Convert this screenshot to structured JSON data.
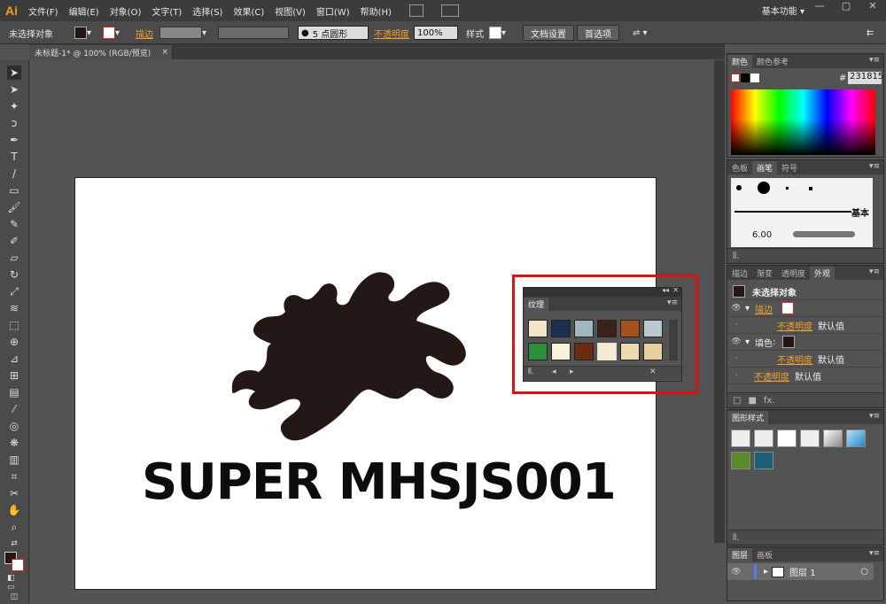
{
  "app": {
    "logo": "Ai"
  },
  "menubar": {
    "items": [
      "文件(F)",
      "编辑(E)",
      "对象(O)",
      "文字(T)",
      "选择(S)",
      "效果(C)",
      "视图(V)",
      "窗口(W)",
      "帮助(H)"
    ],
    "workspace": "基本功能"
  },
  "controlbar": {
    "selection": "未选择对象",
    "stroke_label": "描边",
    "brush_value": "5 点圆形",
    "opacity_label": "不透明度",
    "opacity_value": "100%",
    "style_label": "样式",
    "doc_setup_button": "文档设置",
    "preferences_button": "首选项"
  },
  "document": {
    "tab_title": "未标题-1* @ 100% (RGB/预览)",
    "artwork_text": "SUPER MHSJS001"
  },
  "texture_panel": {
    "title": "纹理"
  },
  "color_panel": {
    "tabs": [
      "颜色",
      "颜色参考"
    ],
    "hex_label": "#",
    "hex_value": "231815"
  },
  "brush_panel": {
    "tabs": [
      "色板",
      "画笔",
      "符号"
    ],
    "basic_label": "基本",
    "size_value": "6.00"
  },
  "appearance_panel": {
    "tabs": [
      "描边",
      "渐变",
      "透明度",
      "外观"
    ],
    "title": "未选择对象",
    "stroke_label": "描边",
    "opacity_label": "不透明度",
    "default_value": "默认值",
    "fill_label": "填色"
  },
  "graphic_styles_panel": {
    "tabs": [
      "图形样式"
    ]
  },
  "layers_panel": {
    "tabs": [
      "图层",
      "画板"
    ],
    "layer_name": "图层 1"
  },
  "colors": {
    "accent": "#f0a030",
    "highlight": "#dd1111",
    "fill": "#231815"
  }
}
